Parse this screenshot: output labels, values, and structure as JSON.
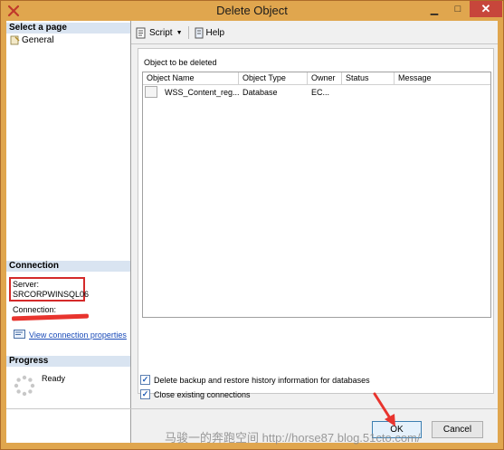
{
  "window": {
    "title": "Delete Object",
    "controls": {
      "minimize": "▁",
      "maximize": "□",
      "close": "✕"
    }
  },
  "left_pane": {
    "select_page_header": "Select a page",
    "pages": [
      {
        "label": "General",
        "icon": "page-icon"
      }
    ],
    "connection_header": "Connection",
    "server_label": "Server:",
    "server_value": "SRCORPWINSQL06",
    "connection_label": "Connection:",
    "view_connection_link": "View connection properties",
    "progress_header": "Progress",
    "progress_status": "Ready"
  },
  "toolbar": {
    "script_label": "Script",
    "help_label": "Help"
  },
  "main": {
    "objects_label": "Object to be deleted",
    "columns": [
      "Object Name",
      "Object Type",
      "Owner",
      "Status",
      "Message"
    ],
    "rows": [
      {
        "object_name": "WSS_Content_reg...",
        "object_type": "Database",
        "owner": "EC...",
        "status": "",
        "message": ""
      }
    ]
  },
  "options": {
    "delete_backup_label": "Delete backup and restore history information for databases",
    "delete_backup_checked": true,
    "close_connections_label": "Close existing connections",
    "close_connections_checked": true
  },
  "buttons": {
    "ok": "OK",
    "cancel": "Cancel"
  },
  "watermark": "马骏一的奔跑空间 http://horse87.blog.51cto.com/",
  "colors": {
    "title_bar": "#e0a64e",
    "close_button": "#c7463b",
    "annotation_red": "#d42a2a",
    "link": "#1a4bb8"
  }
}
